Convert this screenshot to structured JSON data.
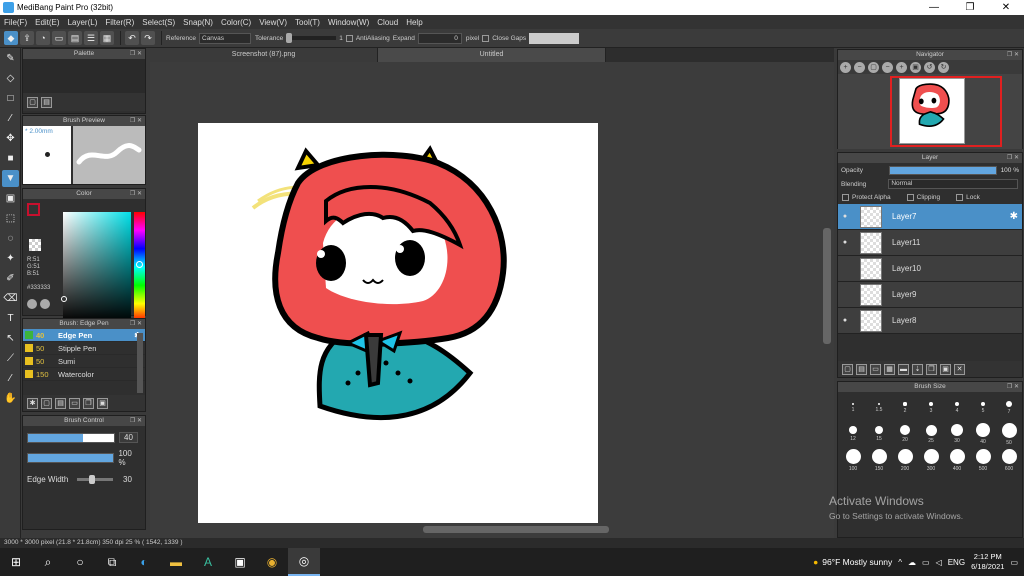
{
  "window": {
    "title": "MediBang Paint Pro (32bit)",
    "controls": [
      "—",
      "❐",
      "✕"
    ]
  },
  "menu": [
    "File(F)",
    "Edit(E)",
    "Layer(L)",
    "Filter(R)",
    "Select(S)",
    "Snap(N)",
    "Color(C)",
    "View(V)",
    "Tool(T)",
    "Window(W)",
    "Cloud",
    "Help"
  ],
  "toolbar": {
    "reference_label": "Reference",
    "reference_value": "Canvas",
    "tolerance_label": "Tolerance",
    "tolerance_value": "1",
    "antialiasing_label": "AntiAliasing",
    "expand_label": "Expand",
    "expand_value": "0",
    "expand_unit": "pixel",
    "close_gaps_label": "Close Gaps"
  },
  "panels": {
    "palette_title": "Palette",
    "brush_preview_title": "Brush Preview",
    "brush_preview_size": "* 2.00mm",
    "color_title": "Color",
    "color_r": "R:51",
    "color_g": "G:51",
    "color_b": "B:51",
    "color_hex": "#333333",
    "brush_title": "Brush: Edge Pen",
    "brush_control_title": "Brush Control",
    "brush_size_value": "40",
    "brush_opacity_value": "100 %",
    "edge_width_label": "Edge Width",
    "edge_width_value": "30"
  },
  "brushes": [
    {
      "size": "40",
      "name": "Edge Pen",
      "color": "#3cb43c",
      "active": true
    },
    {
      "size": "50",
      "name": "Stipple Pen",
      "color": "#e8c020",
      "active": false
    },
    {
      "size": "50",
      "name": "Sumi",
      "color": "#e8c020",
      "active": false
    },
    {
      "size": "150",
      "name": "Watercolor",
      "color": "#e8c020",
      "active": false
    }
  ],
  "doc_tabs": [
    "Screenshot (87).png",
    "Untitled"
  ],
  "navigator": {
    "title": "Navigator"
  },
  "layers": {
    "title": "Layer",
    "opacity_label": "Opacity",
    "opacity_value": "100 %",
    "blending_label": "Blending",
    "blending_value": "Normal",
    "protect_alpha": "Protect Alpha",
    "clipping": "Clipping",
    "lock": "Lock",
    "items": [
      {
        "name": "Layer7",
        "visible": true,
        "active": true
      },
      {
        "name": "Layer11",
        "visible": true,
        "active": false
      },
      {
        "name": "Layer10",
        "visible": false,
        "active": false
      },
      {
        "name": "Layer9",
        "visible": false,
        "active": false
      },
      {
        "name": "Layer8",
        "visible": true,
        "active": false
      }
    ]
  },
  "brush_size": {
    "title": "Brush Size",
    "values": [
      "1",
      "1.5",
      "2",
      "3",
      "4",
      "5",
      "7",
      "12",
      "15",
      "20",
      "25",
      "30",
      "40",
      "50",
      "100",
      "150",
      "200",
      "300",
      "400",
      "500",
      "600"
    ]
  },
  "activation": {
    "line1": "Activate Windows",
    "line2": "Go to Settings to activate Windows."
  },
  "status": "3000 * 3000 pixel   (21.8 * 21.8cm)   350 dpi   25 %   ( 1542, 1339 )",
  "taskbar": {
    "weather": "96°F  Mostly sunny",
    "lang": "ENG",
    "time": "2:12 PM",
    "date": "6/18/2021"
  },
  "colors": {
    "accent": "#4a90c8",
    "hair": "#ef4f4f",
    "cloak": "#23a8b0"
  }
}
